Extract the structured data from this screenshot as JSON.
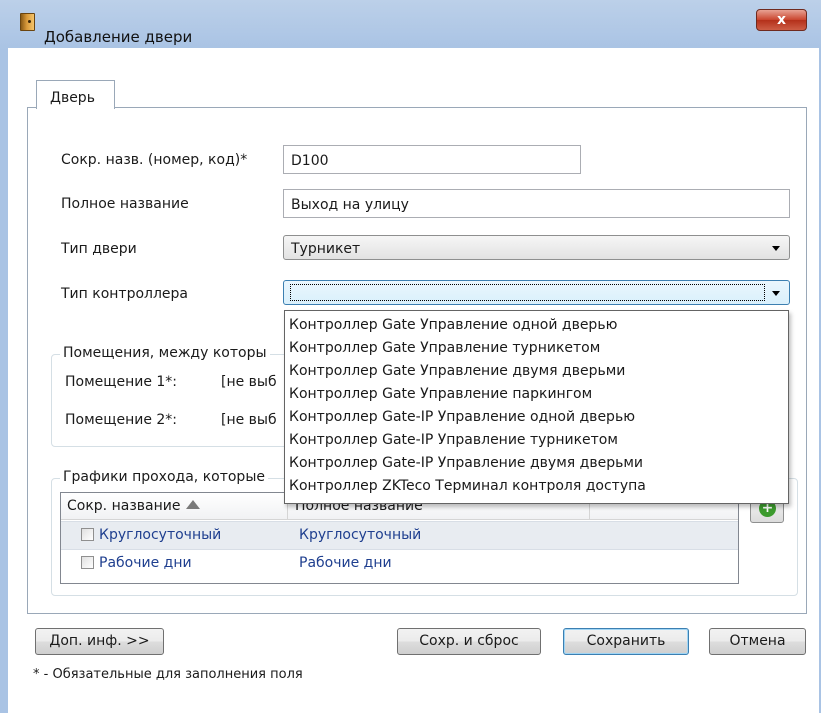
{
  "window": {
    "title": "Добавление двери",
    "close_label": "x"
  },
  "tabs": [
    {
      "label": "Дверь"
    }
  ],
  "form": {
    "short_name": {
      "label": "Сокр. назв. (номер, код)*",
      "value": "D100"
    },
    "full_name": {
      "label": "Полное название",
      "value": "Выход на улицу"
    },
    "door_type": {
      "label": "Тип двери",
      "value": "Турникет"
    },
    "controller_type": {
      "label": "Тип контроллера",
      "value": ""
    }
  },
  "rooms_group": {
    "title": "Помещения, между которы",
    "room1": {
      "label": "Помещение 1*:",
      "value": "[не выб"
    },
    "room2": {
      "label": "Помещение 2*:",
      "value": "[не выб"
    }
  },
  "schedules_group": {
    "title": "Графики прохода, которые",
    "columns": [
      "Сокр. название",
      "Полное название"
    ],
    "rows": [
      {
        "short": "Круглосуточный",
        "full": "Круглосуточный",
        "checked": false,
        "selected": true
      },
      {
        "short": "Рабочие дни",
        "full": "Рабочие дни",
        "checked": false,
        "selected": false
      }
    ],
    "add_icon": "plus-icon"
  },
  "controller_dropdown": {
    "options": [
      "Контроллер Gate Управление одной дверью",
      "Контроллер Gate Управление турникетом",
      "Контроллер Gate Управление двумя дверьми",
      "Контроллер Gate Управление паркингом",
      "Контроллер Gate-IP Управление одной дверью",
      "Контроллер Gate-IP Управление турникетом",
      "Контроллер Gate-IP Управление двумя дверьми",
      "Контроллер ZKTeco Терминал контроля доступа"
    ]
  },
  "buttons": {
    "more_info": "Доп. инф. >>",
    "save_reset": "Сохр. и сброс",
    "save": "Сохранить",
    "cancel": "Отмена"
  },
  "footer_note": "* - Обязательные для заполнения поля",
  "colors": {
    "title_gradient": "#a9c3e4",
    "close_red": "#c9442d",
    "link_blue": "#1f3f8f",
    "focus_blue": "#3c7fb1",
    "add_green": "#3c9b2e"
  }
}
